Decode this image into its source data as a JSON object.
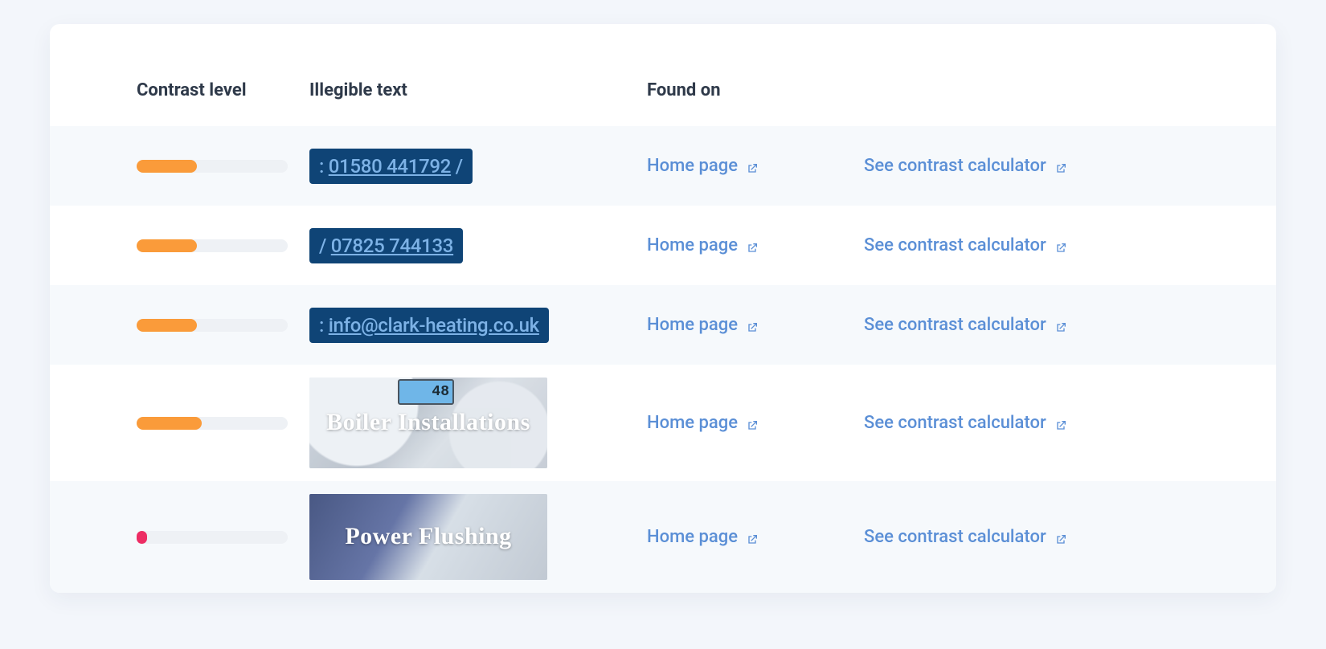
{
  "headers": {
    "contrast": "Contrast level",
    "illegible": "Illegible text",
    "found_on": "Found on"
  },
  "link_texts": {
    "found_on": "Home page",
    "action": "See contrast calculator"
  },
  "rows": [
    {
      "bar_pct": 40,
      "bar_color": "orange",
      "preview_kind": "chip",
      "preview_prefix": ": ",
      "preview_text": "01580 441792",
      "preview_suffix": " /"
    },
    {
      "bar_pct": 40,
      "bar_color": "orange",
      "preview_kind": "chip",
      "preview_prefix": "/ ",
      "preview_text": "07825 744133",
      "preview_suffix": ""
    },
    {
      "bar_pct": 40,
      "bar_color": "orange",
      "preview_kind": "chip",
      "preview_prefix": ": ",
      "preview_text": "info@clark-heating.co.uk",
      "preview_suffix": ""
    },
    {
      "bar_pct": 43,
      "bar_color": "orange",
      "preview_kind": "image",
      "preview_variant": "boiler",
      "preview_text": "Boiler Installations",
      "lcd_text": "48"
    },
    {
      "bar_pct": 7,
      "bar_color": "red",
      "preview_kind": "image",
      "preview_variant": "power",
      "preview_text": "Power Flushing"
    }
  ]
}
